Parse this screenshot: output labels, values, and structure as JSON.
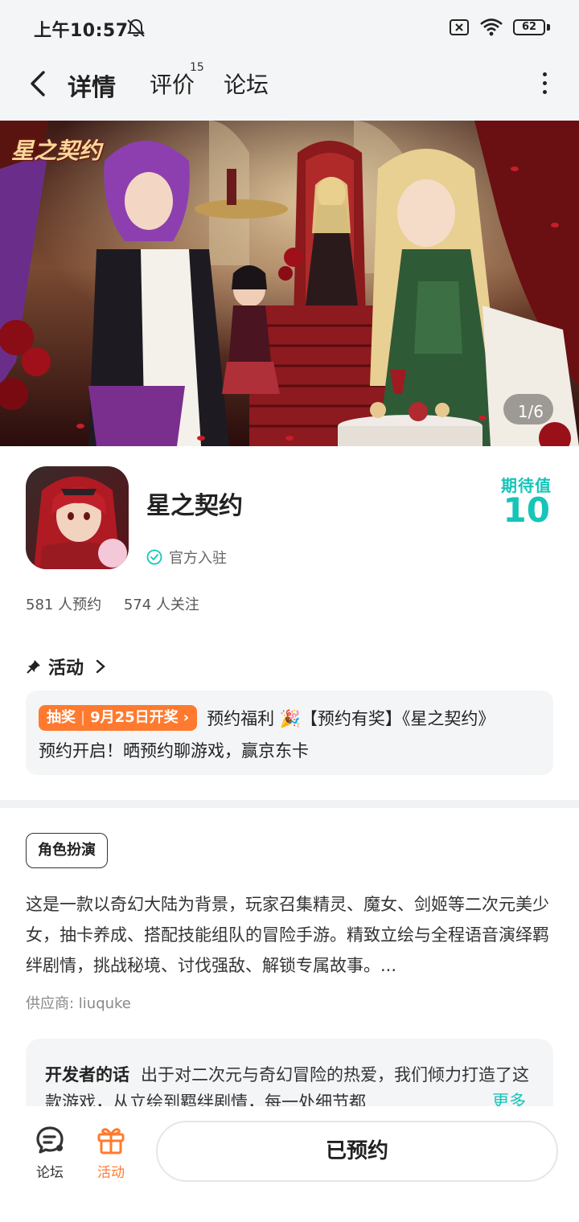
{
  "status_bar": {
    "time": "上午10:57",
    "battery": "62",
    "icons": [
      "bell-muted-icon",
      "sim-x-icon",
      "wifi-icon",
      "battery-icon"
    ]
  },
  "nav": {
    "tabs": [
      {
        "label": "详情",
        "active": true
      },
      {
        "label": "评价",
        "badge": "15"
      },
      {
        "label": "论坛"
      }
    ],
    "icons": [
      "back-arrow-icon",
      "more-vert-icon"
    ]
  },
  "banner": {
    "logo_text": "星之契约",
    "counter": "1/6"
  },
  "app": {
    "name": "星之契约",
    "official_label": "官方入驻",
    "expect_label": "期待值",
    "expect_value": "10",
    "reservations": "581 人预约",
    "followers": "574 人关注"
  },
  "activity": {
    "heading": "活动",
    "tag_type": "抽奖",
    "tag_date": "9月25日开奖",
    "line1": "预约福利 🎉【预约有奖】《星之契约》",
    "line2": "预约开启！晒预约聊游戏，赢京东卡"
  },
  "description": {
    "genre": "角色扮演",
    "text": "这是一款以奇幻大陆为背景，玩家召集精灵、魔女、剑姬等二次元美少女，抽卡养成、搭配技能组队的冒险手游。精致立绘与全程语音演绎羁绊剧情，挑战秘境、讨伐强敌、解锁专属故事。...",
    "supplier": "供应商: liuquke"
  },
  "developer": {
    "title": "开发者的话",
    "text": "出于对二次元与奇幻冒险的热爱，我们倾力打造了这款游戏，从立绘到羁绊剧情，每一处细节都",
    "more": "更多"
  },
  "bottom": {
    "forum_label": "论坛",
    "activity_label": "活动",
    "reserve_label": "已预约"
  },
  "colors": {
    "accent": "#15c5b8",
    "orange": "#ff7a2f"
  }
}
